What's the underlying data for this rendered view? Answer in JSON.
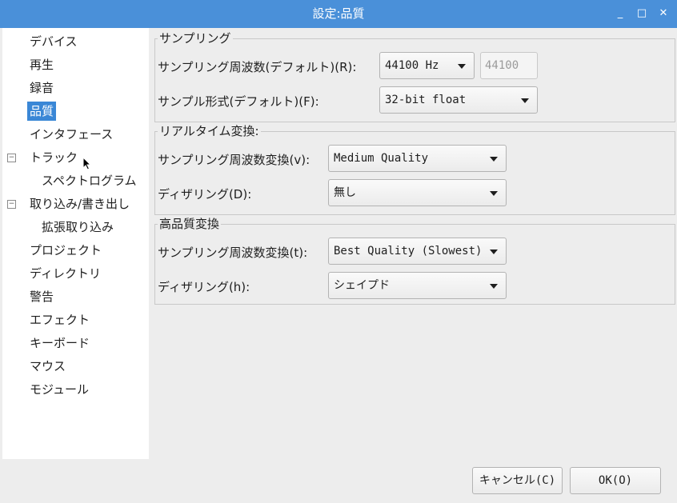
{
  "window": {
    "title": "設定:品質",
    "minimize": "_",
    "maximize": "□",
    "close": "✕"
  },
  "sidebar": {
    "items": [
      {
        "label": "デバイス"
      },
      {
        "label": "再生"
      },
      {
        "label": "録音"
      },
      {
        "label": "品質",
        "selected": true
      },
      {
        "label": "インタフェース"
      },
      {
        "label": "トラック",
        "expander": "−"
      },
      {
        "label": "スペクトログラム"
      },
      {
        "label": "取り込み/書き出し",
        "expander": "−"
      },
      {
        "label": "拡張取り込み"
      },
      {
        "label": "プロジェクト"
      },
      {
        "label": "ディレクトリ"
      },
      {
        "label": "警告"
      },
      {
        "label": "エフェクト"
      },
      {
        "label": "キーボード"
      },
      {
        "label": "マウス"
      },
      {
        "label": "モジュール"
      }
    ]
  },
  "sampling": {
    "title": "サンプリング",
    "rate_label": "サンプリング周波数(デフォルト)(R):",
    "rate_value": "44100 Hz",
    "rate_custom": "44100",
    "format_label": "サンプル形式(デフォルト)(F):",
    "format_value": "32-bit float"
  },
  "realtime": {
    "title": "リアルタイム変換:",
    "conv_label": "サンプリング周波数変換(v):",
    "conv_value": "Medium Quality",
    "dither_label": "ディザリング(D):",
    "dither_value": "無し"
  },
  "highquality": {
    "title": "高品質変換",
    "conv_label": "サンプリング周波数変換(t):",
    "conv_value": "Best Quality (Slowest)",
    "dither_label": "ディザリング(h):",
    "dither_value": "シェイプド"
  },
  "buttons": {
    "cancel": "キャンセル(C)",
    "ok": "OK(O)"
  },
  "colors": {
    "titlebar": "#4a90d9",
    "selection": "#3a87d6"
  }
}
